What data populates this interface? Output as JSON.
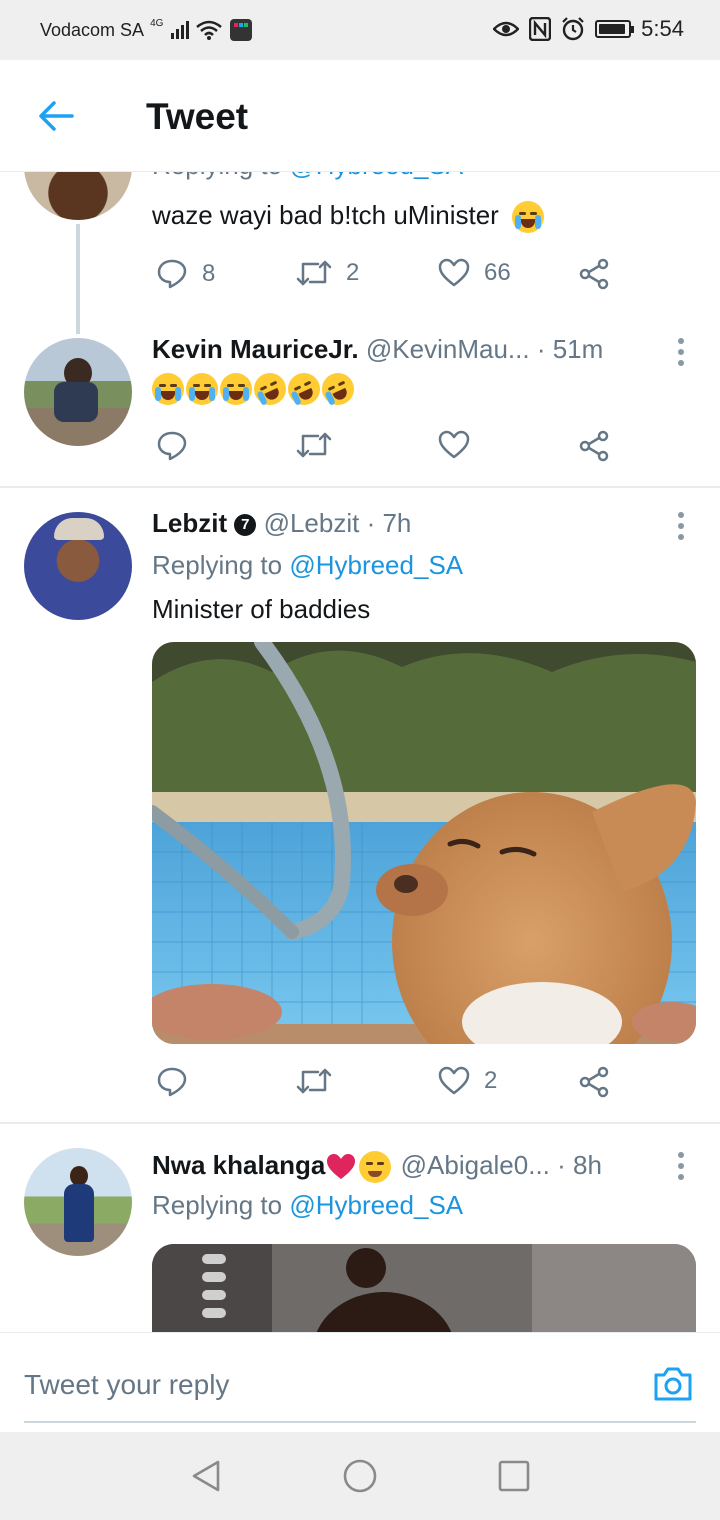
{
  "status_bar": {
    "carrier": "Vodacom SA",
    "network": "4G",
    "time": "5:54",
    "icons": [
      "eye-icon",
      "nfc-icon",
      "alarm-icon",
      "battery-icon"
    ]
  },
  "header": {
    "title": "Tweet"
  },
  "tweets": [
    {
      "replying_prefix": "Replying to ",
      "replying_to": "@Hybreed_SA",
      "text": "waze wayi bad b!tch uMinister",
      "emojis": [
        "loudly-crying-face"
      ],
      "reply_count": "8",
      "retweet_count": "2",
      "like_count": "66"
    },
    {
      "name": "Kevin MauriceJr.",
      "handle": "@KevinMau...",
      "time": "· 51m",
      "emojis": [
        "loudly-crying-face",
        "loudly-crying-face",
        "loudly-crying-face",
        "rolling-on-the-floor-laughing",
        "rolling-on-the-floor-laughing",
        "rolling-on-the-floor-laughing"
      ],
      "reply_count": "",
      "retweet_count": "",
      "like_count": ""
    },
    {
      "name": "Lebzit",
      "badge": "7",
      "handle": "@Lebzit",
      "time": "· 7h",
      "replying_prefix": "Replying to ",
      "replying_to": "@Hybreed_SA",
      "text": "Minister of baddies",
      "media": "chihuahua in swimming pool",
      "reply_count": "",
      "retweet_count": "",
      "like_count": "2"
    },
    {
      "name": "Nwa khalanga",
      "name_emojis": [
        "red-heart",
        "smiling-face-with-smiling-eyes"
      ],
      "handle": "@Abigale0...",
      "time": "· 8h",
      "replying_prefix": "Replying to ",
      "replying_to": "@Hybreed_SA",
      "media": "woman photo"
    }
  ],
  "reply_bar": {
    "placeholder": "Tweet your reply"
  },
  "colors": {
    "accent": "#1b95e0",
    "muted": "#657786",
    "like": "#657786",
    "divider": "#e6ecf0"
  }
}
